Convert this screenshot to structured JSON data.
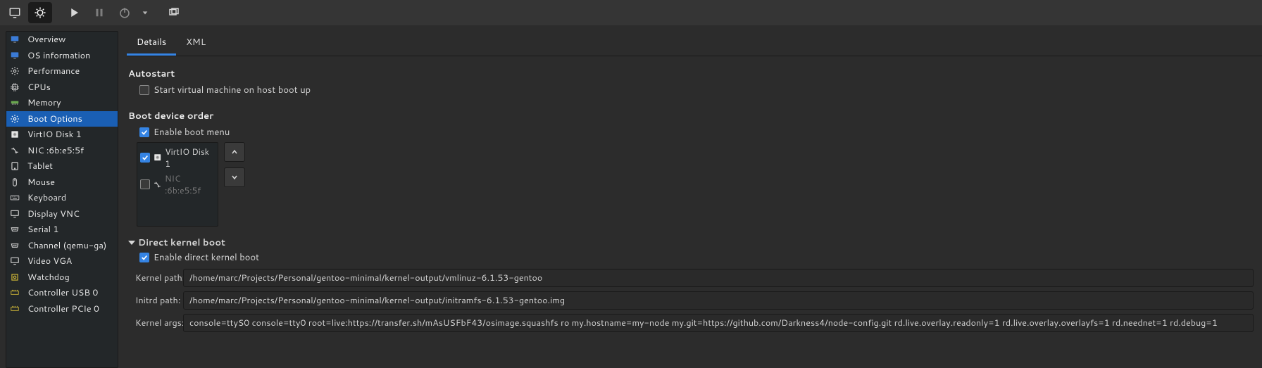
{
  "sidebar": {
    "items": [
      {
        "label": "Overview",
        "icon": "monitor-blue"
      },
      {
        "label": "OS information",
        "icon": "monitor-blue"
      },
      {
        "label": "Performance",
        "icon": "gear"
      },
      {
        "label": "CPUs",
        "icon": "cpu"
      },
      {
        "label": "Memory",
        "icon": "memory"
      },
      {
        "label": "Boot Options",
        "icon": "gear"
      },
      {
        "label": "VirtIO Disk 1",
        "icon": "disk"
      },
      {
        "label": "NIC :6b:e5:5f",
        "icon": "nic"
      },
      {
        "label": "Tablet",
        "icon": "tablet"
      },
      {
        "label": "Mouse",
        "icon": "mouse"
      },
      {
        "label": "Keyboard",
        "icon": "keyboard"
      },
      {
        "label": "Display VNC",
        "icon": "monitor"
      },
      {
        "label": "Serial 1",
        "icon": "serial"
      },
      {
        "label": "Channel (qemu-ga)",
        "icon": "serial"
      },
      {
        "label": "Video VGA",
        "icon": "monitor"
      },
      {
        "label": "Watchdog",
        "icon": "watchdog"
      },
      {
        "label": "Controller USB 0",
        "icon": "controller"
      },
      {
        "label": "Controller PCIe 0",
        "icon": "controller"
      }
    ],
    "selected_index": 5
  },
  "tabs": {
    "items": [
      "Details",
      "XML"
    ],
    "active_index": 0
  },
  "autostart": {
    "title": "Autostart",
    "checkbox_label": "Start virtual machine on host boot up",
    "checked": false
  },
  "boot_order": {
    "title": "Boot device order",
    "enable_label": "Enable boot menu",
    "enable_checked": true,
    "devices": [
      {
        "label": "VirtIO Disk 1",
        "checked": true,
        "enabled": true,
        "icon": "disk"
      },
      {
        "label": "NIC :6b:e5:5f",
        "checked": false,
        "enabled": false,
        "icon": "nic"
      }
    ]
  },
  "direct_kernel": {
    "title": "Direct kernel boot",
    "enable_label": "Enable direct kernel boot",
    "enable_checked": true,
    "fields": [
      {
        "label": "Kernel path:",
        "value": "/home/marc/Projects/Personal/gentoo-minimal/kernel-output/vmlinuz-6.1.53-gentoo"
      },
      {
        "label": "Initrd path:",
        "value": "/home/marc/Projects/Personal/gentoo-minimal/kernel-output/initramfs-6.1.53-gentoo.img"
      },
      {
        "label": "Kernel args:",
        "value": "console=ttyS0 console=tty0 root=live:https://transfer.sh/mAsUSFbF43/osimage.squashfs ro my.hostname=my-node my.git=https://github.com/Darkness4/node-config.git rd.live.overlay.readonly=1 rd.live.overlay.overlayfs=1 rd.neednet=1 rd.debug=1"
      }
    ]
  }
}
